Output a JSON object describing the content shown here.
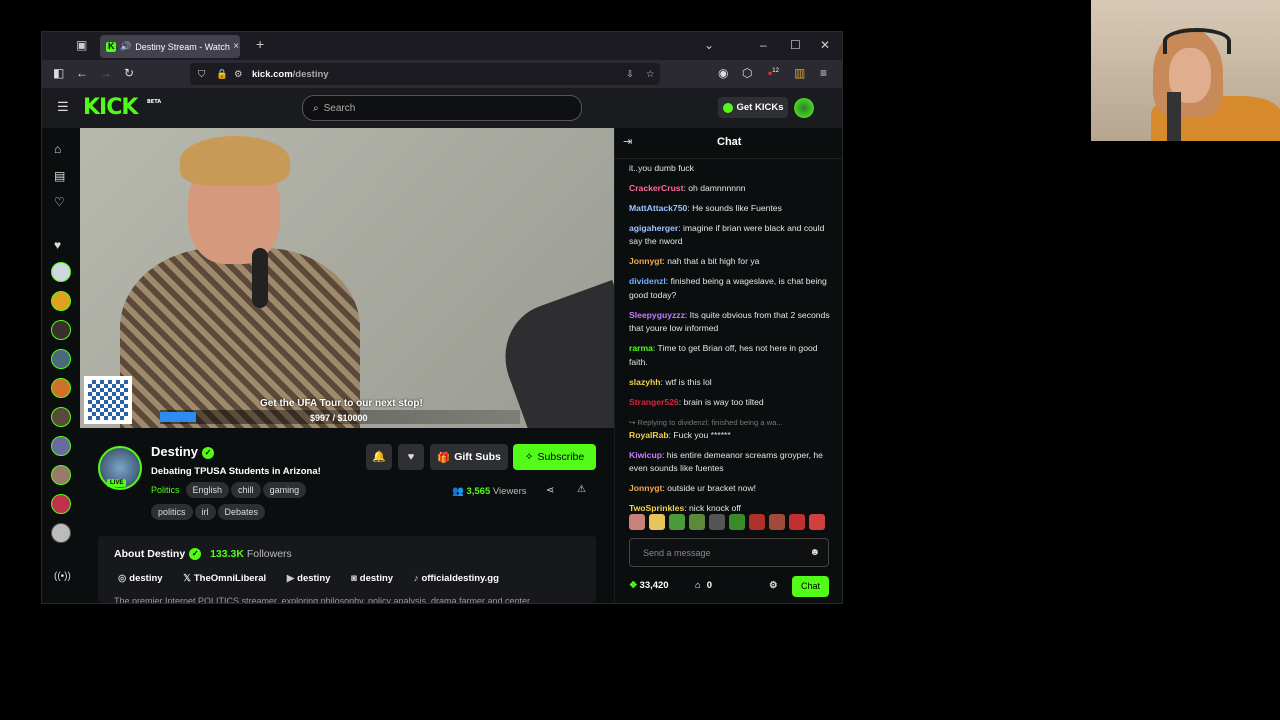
{
  "browser": {
    "tab_title": "Destiny Stream - Watch Live",
    "url_host": "kick.com",
    "url_path": "/destiny",
    "ext_badge": "12"
  },
  "header": {
    "logo": "KICK",
    "logo_badge": "BETA",
    "search_placeholder": "Search",
    "get_kicks": "Get KICKs"
  },
  "video": {
    "promo": "Get the UFA Tour to our next stop!",
    "goal_text": "$997 / $10000",
    "goal_progress": 0.0997
  },
  "channel": {
    "name": "Destiny",
    "live_badge": "LIVE",
    "stream_title": "Debating TPUSA Students in Arizona!",
    "category": "Politics",
    "tags": [
      "English",
      "chill",
      "gaming",
      "politics",
      "irl",
      "Debates"
    ],
    "gift_subs": "Gift Subs",
    "subscribe": "Subscribe",
    "viewers_count": "3,565",
    "viewers_label": "Viewers"
  },
  "about": {
    "title": "About Destiny",
    "followers_count": "133.3K",
    "followers_label": "Followers",
    "socials": [
      {
        "icon": "instagram-icon",
        "label": "destiny"
      },
      {
        "icon": "x-icon",
        "label": "TheOmniLiberal"
      },
      {
        "icon": "youtube-icon",
        "label": "destiny"
      },
      {
        "icon": "discord-icon",
        "label": "destiny"
      },
      {
        "icon": "tiktok-icon",
        "label": "officialdestiny.gg"
      }
    ],
    "description": "The premier Internet POLITICS streamer, exploring philosophy, policy analysis, drama farmer and center"
  },
  "chat": {
    "title": "Chat",
    "messages": [
      {
        "user": "",
        "text": "it..you dumb fuck",
        "color": "#e6e6e6"
      },
      {
        "user": "CrackerCrust",
        "text": "oh damnnnnnn",
        "color": "#ff6b9b"
      },
      {
        "user": "MattAttack750",
        "text": "He sounds like Fuentes",
        "color": "#9ec3ff"
      },
      {
        "user": "agigaherger",
        "text": "imagine if brian were black and could say the nword",
        "color": "#9ec3ff"
      },
      {
        "user": "Jonnygt",
        "text": "nah that a bit high for ya",
        "color": "#f2a84a"
      },
      {
        "user": "dividenzl",
        "text": "finished being a wageslave, is chat being good today?",
        "color": "#6fb0ff"
      },
      {
        "user": "Sleepyguyzzz",
        "text": "Its quite obvious from that 2 seconds that youre low informed",
        "color": "#c77dff"
      },
      {
        "user": "rarma",
        "text": "Time to get Brian off, hes not here in good faith.",
        "color": "#53fc18"
      },
      {
        "user": "slazyhh",
        "text": "wtf is this lol",
        "color": "#f2d14a"
      },
      {
        "user": "Stranger526",
        "text": "brain is way too tilted",
        "color": "#e0223b"
      },
      {
        "reply": "Replying to dividenzl:",
        "reply_text": "finished being a wa..."
      },
      {
        "user": "RoyalRab",
        "text": "Fuck you ******",
        "color": "#f2d14a"
      },
      {
        "user": "Kiwicup",
        "text": "his entire demeanor screams groyper, he even sounds like fuentes",
        "color": "#c77dff"
      },
      {
        "user": "Jonnygt",
        "text": "outside ur bracket now!",
        "color": "#f2a84a"
      },
      {
        "user": "TwoSprinkles",
        "text": "nick knock off",
        "color": "#f2d14a"
      }
    ],
    "input_placeholder": "Send a message",
    "points": "33,420",
    "store_count": "0",
    "chat_button": "Chat"
  }
}
